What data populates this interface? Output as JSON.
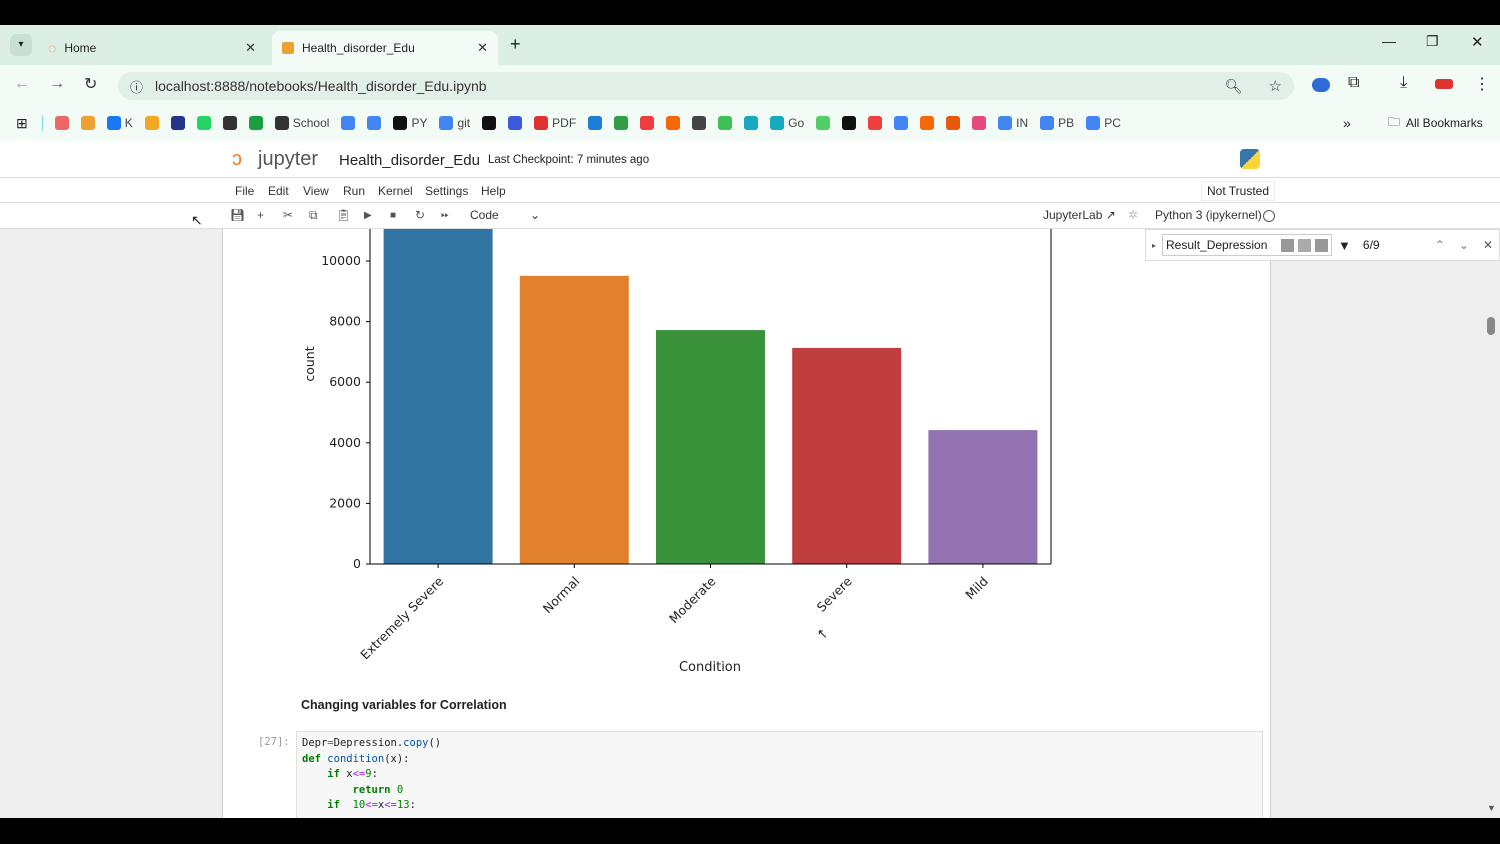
{
  "browser": {
    "tabs": [
      {
        "label": "Home",
        "active": false
      },
      {
        "label": "Health_disorder_Edu",
        "active": true
      }
    ],
    "url": "localhost:8888/notebooks/Health_disorder_Edu.ipynb",
    "bookmarks": [
      {
        "label": "",
        "color": "#e66"
      },
      {
        "label": "",
        "color": "#f0a030"
      },
      {
        "label": "K",
        "color": "#1877f2"
      },
      {
        "label": "",
        "color": "#f5a623"
      },
      {
        "label": "",
        "color": "#223388"
      },
      {
        "label": "",
        "color": "#25d366"
      },
      {
        "label": "",
        "color": "#333"
      },
      {
        "label": "",
        "color": "#1a9e3f"
      },
      {
        "label": "School",
        "color": "#333"
      },
      {
        "label": "",
        "color": "#4285f4"
      },
      {
        "label": "",
        "color": "#4285f4"
      },
      {
        "label": "PY",
        "color": "#111"
      },
      {
        "label": "git",
        "color": "#4285f4"
      },
      {
        "label": "",
        "color": "#111"
      },
      {
        "label": "",
        "color": "#3b5bdb"
      },
      {
        "label": "PDF",
        "color": "#e03131"
      },
      {
        "label": "",
        "color": "#1c7ed6"
      },
      {
        "label": "",
        "color": "#2f9e44"
      },
      {
        "label": "",
        "color": "#f03e3e"
      },
      {
        "label": "",
        "color": "#f76707"
      },
      {
        "label": "",
        "color": "#444"
      },
      {
        "label": "",
        "color": "#40c057"
      },
      {
        "label": "",
        "color": "#15aabf"
      },
      {
        "label": "Go",
        "color": "#15aabf"
      },
      {
        "label": "",
        "color": "#51cf66"
      },
      {
        "label": "",
        "color": "#111"
      },
      {
        "label": "",
        "color": "#f03e3e"
      },
      {
        "label": "",
        "color": "#4285f4"
      },
      {
        "label": "",
        "color": "#f76707"
      },
      {
        "label": "",
        "color": "#e8590c"
      },
      {
        "label": "",
        "color": "#e64980"
      },
      {
        "label": "IN",
        "color": "#4285f4"
      },
      {
        "label": "PB",
        "color": "#4285f4"
      },
      {
        "label": "PC",
        "color": "#4285f4"
      }
    ],
    "all_bookmarks": "All Bookmarks"
  },
  "jupyter": {
    "logo": "jupyter",
    "notebook_title": "Health_disorder_Edu",
    "checkpoint": "Last Checkpoint: 7 minutes ago",
    "menu": [
      "File",
      "Edit",
      "View",
      "Run",
      "Kernel",
      "Settings",
      "Help"
    ],
    "trust": "Not Trusted",
    "cell_type": "Code",
    "jupyterlab": "JupyterLab",
    "kernel": "Python 3 (ipykernel)",
    "search": {
      "value": "Result_Depression",
      "count": "6/9"
    }
  },
  "chart_data": {
    "type": "bar",
    "xlabel": "Condition",
    "ylabel": "count",
    "categories": [
      "Extremely Severe",
      "Normal",
      "Moderate",
      "Severe",
      "Mild"
    ],
    "values": [
      11000,
      8850,
      7060,
      6470,
      3760
    ],
    "colors": [
      "#3274a1",
      "#e1812c",
      "#3a923a",
      "#c03d3e",
      "#9372b2"
    ],
    "yticks": [
      0,
      2000,
      4000,
      6000,
      8000,
      10000
    ],
    "ylim": [
      0,
      11000
    ]
  },
  "markdown_heading": "Changing variables for Correlation",
  "cell": {
    "prompt": "[27]:"
  }
}
